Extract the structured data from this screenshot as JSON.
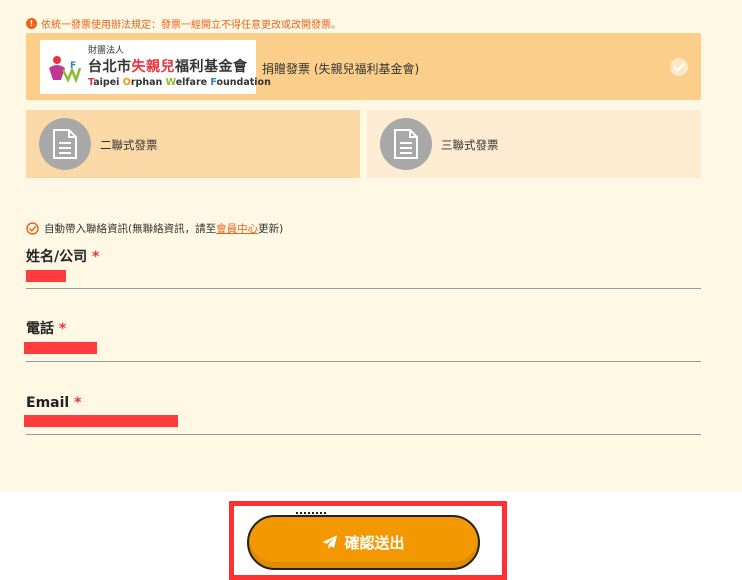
{
  "notice": "依統一發票使用辦法規定：發票一經開立不得任意更改或改開發票。",
  "donate": {
    "logo_small": "財團法人",
    "logo_cn_a": "台北市",
    "logo_cn_b": "失親兒",
    "logo_cn_c": "福利基金會",
    "logo_en_1": "T",
    "logo_en_2": "aipei ",
    "logo_en_3": "O",
    "logo_en_4": "rphan ",
    "logo_en_5": "W",
    "logo_en_6": "elfare ",
    "logo_en_7": "F",
    "logo_en_8": "oundation",
    "label": "捐贈發票 (失親兒福利基金會)"
  },
  "invoice_types": [
    "二聯式發票",
    "三聯式發票"
  ],
  "autofill": {
    "prefix": "自動帶入聯絡資訊(無聯絡資訊，請至",
    "link": "會員中心",
    "suffix": "更新)"
  },
  "fields": {
    "name_label": "姓名/公司",
    "phone_label": "電話",
    "email_label": "Email",
    "required_mark": "*"
  },
  "submit_label": "確認送出",
  "colors": {
    "accent": "#f39800",
    "selected_card": "#fbcf8a",
    "required": "#e8343c",
    "highlight_frame": "#ff3030"
  }
}
